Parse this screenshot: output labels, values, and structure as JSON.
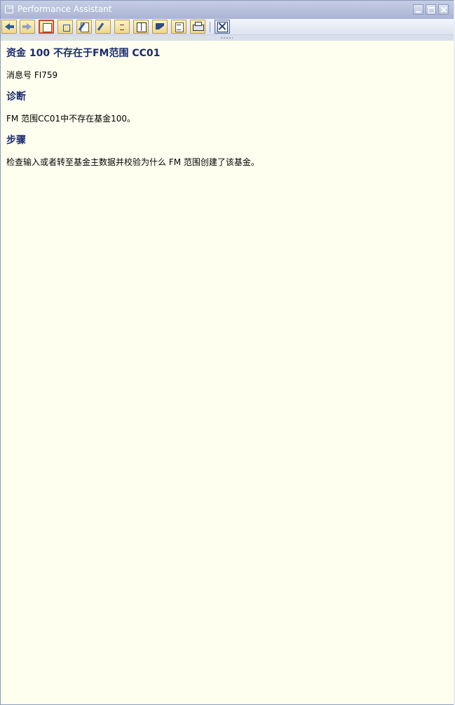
{
  "window": {
    "title": "Performance Assistant"
  },
  "toolbar": {
    "buttons": [
      {
        "icon": "back-arrow-icon"
      },
      {
        "icon": "forward-arrow-icon"
      },
      {
        "icon": "technical-info-icon"
      },
      {
        "icon": "navigate-icon"
      },
      {
        "icon": "edit-icon"
      },
      {
        "icon": "pencil-icon"
      },
      {
        "icon": "info-icon"
      },
      {
        "icon": "book-icon"
      },
      {
        "icon": "flag-icon"
      },
      {
        "icon": "copy-icon"
      },
      {
        "icon": "print-icon"
      },
      {
        "icon": "exit-icon"
      }
    ]
  },
  "content": {
    "title": "资金 100 不存在于FM范围 CC01",
    "message_no": "消息号 FI759",
    "diagnosis_heading": "诊断",
    "diagnosis_text": "FM 范围CC01中不存在基金100。",
    "procedure_heading": "步骤",
    "procedure_text": "检查输入或者转至基金主数据并校验为什么 FM 范围创建了该基金。"
  },
  "colors": {
    "titlebar": "#aab4d3",
    "background": "#fffff0",
    "heading": "#1a2a6c"
  }
}
